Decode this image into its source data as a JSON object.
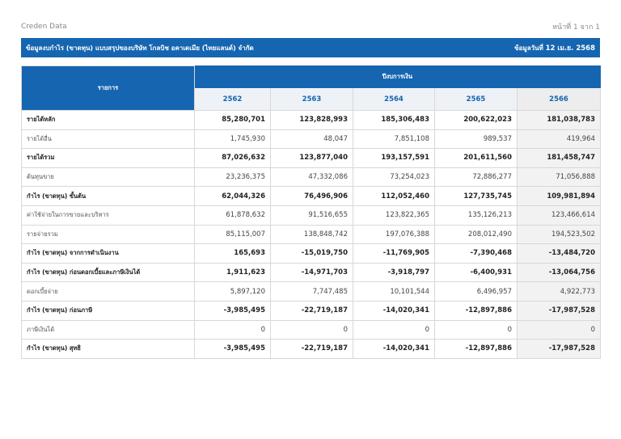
{
  "header": {
    "brand": "Creden Data",
    "page_info": "หน้าที่ 1 จาก 1"
  },
  "title_bar": {
    "title": "ข้อมูลงบกำไร (ขาดทุน) แบบสรุปของบริษัท โกลบิช อคาเดเมีย (ไทยแลนด์) จำกัด",
    "date_label": "ข้อมูลวันที่",
    "date_value": "12 เม.ย. 2568"
  },
  "table": {
    "item_header": "รายการ",
    "year_group_header": "ปีงบการเงิน",
    "years": [
      "2562",
      "2563",
      "2564",
      "2565",
      "2566"
    ],
    "rows": [
      {
        "label": "รายได้หลัก",
        "bold": true,
        "values": [
          "85,280,701",
          "123,828,993",
          "185,306,483",
          "200,622,023",
          "181,038,783"
        ]
      },
      {
        "label": "รายได้อื่น",
        "bold": false,
        "values": [
          "1,745,930",
          "48,047",
          "7,851,108",
          "989,537",
          "419,964"
        ]
      },
      {
        "label": "รายได้รวม",
        "bold": true,
        "values": [
          "87,026,632",
          "123,877,040",
          "193,157,591",
          "201,611,560",
          "181,458,747"
        ]
      },
      {
        "label": "ต้นทุนขาย",
        "bold": false,
        "values": [
          "23,236,375",
          "47,332,086",
          "73,254,023",
          "72,886,277",
          "71,056,888"
        ]
      },
      {
        "label": "กำไร (ขาดทุน) ขั้นต้น",
        "bold": true,
        "values": [
          "62,044,326",
          "76,496,906",
          "112,052,460",
          "127,735,745",
          "109,981,894"
        ]
      },
      {
        "label": "ค่าใช้จ่ายในการขายและบริหาร",
        "bold": false,
        "values": [
          "61,878,632",
          "91,516,655",
          "123,822,365",
          "135,126,213",
          "123,466,614"
        ]
      },
      {
        "label": "รายจ่ายรวม",
        "bold": false,
        "values": [
          "85,115,007",
          "138,848,742",
          "197,076,388",
          "208,012,490",
          "194,523,502"
        ]
      },
      {
        "label": "กำไร (ขาดทุน) จากการดำเนินงาน",
        "bold": true,
        "values": [
          "165,693",
          "-15,019,750",
          "-11,769,905",
          "-7,390,468",
          "-13,484,720"
        ]
      },
      {
        "label": "กำไร (ขาดทุน) ก่อนดอกเบี้ยและภาษีเงินได้",
        "bold": true,
        "values": [
          "1,911,623",
          "-14,971,703",
          "-3,918,797",
          "-6,400,931",
          "-13,064,756"
        ]
      },
      {
        "label": "ดอกเบี้ยจ่าย",
        "bold": false,
        "values": [
          "5,897,120",
          "7,747,485",
          "10,101,544",
          "6,496,957",
          "4,922,773"
        ]
      },
      {
        "label": "กำไร (ขาดทุน) ก่อนภาษี",
        "bold": true,
        "values": [
          "-3,985,495",
          "-22,719,187",
          "-14,020,341",
          "-12,897,886",
          "-17,987,528"
        ]
      },
      {
        "label": "ภาษีเงินได้",
        "bold": false,
        "values": [
          "0",
          "0",
          "0",
          "0",
          "0"
        ]
      },
      {
        "label": "กำไร (ขาดทุน) สุทธิ",
        "bold": true,
        "values": [
          "-3,985,495",
          "-22,719,187",
          "-14,020,341",
          "-12,897,886",
          "-17,987,528"
        ]
      }
    ]
  }
}
